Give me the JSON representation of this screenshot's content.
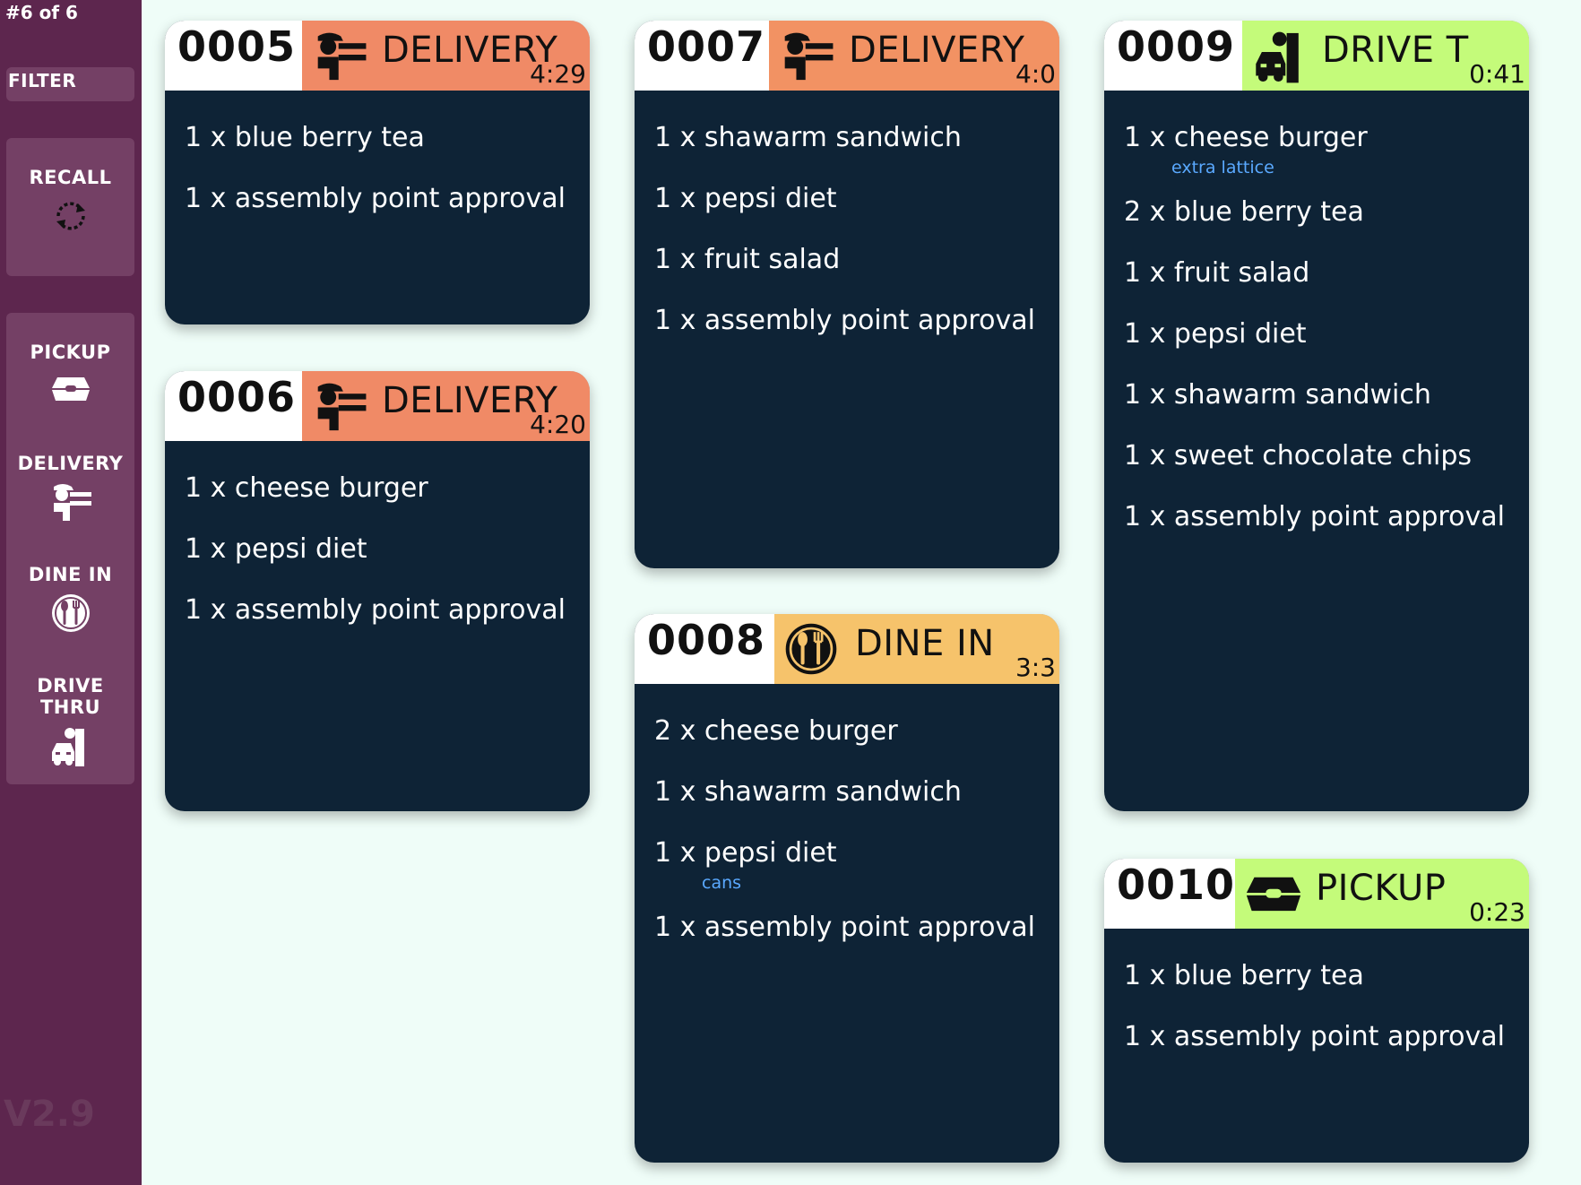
{
  "header": {
    "page_counter": "#6 of 6"
  },
  "sidebar": {
    "filter_label": "FILTER",
    "recall": {
      "label": "RECALL",
      "icon": "recall-icon"
    },
    "filters": [
      {
        "label": "PICKUP",
        "icon": "pickup-box-icon"
      },
      {
        "label": "DELIVERY",
        "icon": "delivery-person-icon"
      },
      {
        "label": "DINE IN",
        "icon": "dine-in-fork-spoon-icon"
      },
      {
        "label": "DRIVE THRU",
        "icon": "drive-thru-car-icon"
      }
    ],
    "version": "V2.9"
  },
  "colors": {
    "sidebar_bg": "#5d264e",
    "card_bg": "#0e2336",
    "delivery_tag": "#f08a66",
    "dine_in_tag": "#f6c36b",
    "pickup_drive_tag": "#c4fb7a",
    "modifier_text": "#5aa9ff"
  },
  "orders": [
    {
      "number": "0005",
      "type": "DELIVERY",
      "timer": "4:29",
      "items": [
        {
          "text": "1 x blue berry tea"
        },
        {
          "text": "1 x assembly point approval"
        }
      ]
    },
    {
      "number": "0006",
      "type": "DELIVERY",
      "timer": "4:20",
      "items": [
        {
          "text": "1 x cheese burger"
        },
        {
          "text": "1 x pepsi diet"
        },
        {
          "text": "1 x assembly point approval"
        }
      ]
    },
    {
      "number": "0007",
      "type": "DELIVERY",
      "timer": "4:0",
      "items": [
        {
          "text": "1 x shawarm sandwich"
        },
        {
          "text": "1 x pepsi diet"
        },
        {
          "text": "1 x fruit salad"
        },
        {
          "text": "1 x assembly point approval"
        }
      ]
    },
    {
      "number": "0008",
      "type": "DINE IN",
      "timer": "3:3",
      "items": [
        {
          "text": "2 x cheese burger"
        },
        {
          "text": "1 x shawarm sandwich"
        },
        {
          "text": "1 x pepsi diet",
          "modifier": "cans"
        },
        {
          "text": "1 x assembly point approval"
        }
      ]
    },
    {
      "number": "0009",
      "type": "DRIVE T",
      "timer": "0:41",
      "items": [
        {
          "text": "1 x cheese burger",
          "modifier": "extra lattice"
        },
        {
          "text": "2 x blue berry tea"
        },
        {
          "text": "1 x fruit salad"
        },
        {
          "text": "1 x pepsi diet"
        },
        {
          "text": "1 x shawarm sandwich"
        },
        {
          "text": "1 x sweet chocolate chips"
        },
        {
          "text": "1 x assembly point approval"
        }
      ]
    },
    {
      "number": "0010",
      "type": "PICKUP",
      "timer": "0:23",
      "items": [
        {
          "text": "1 x blue berry tea"
        },
        {
          "text": "1 x assembly point approval"
        }
      ]
    }
  ]
}
